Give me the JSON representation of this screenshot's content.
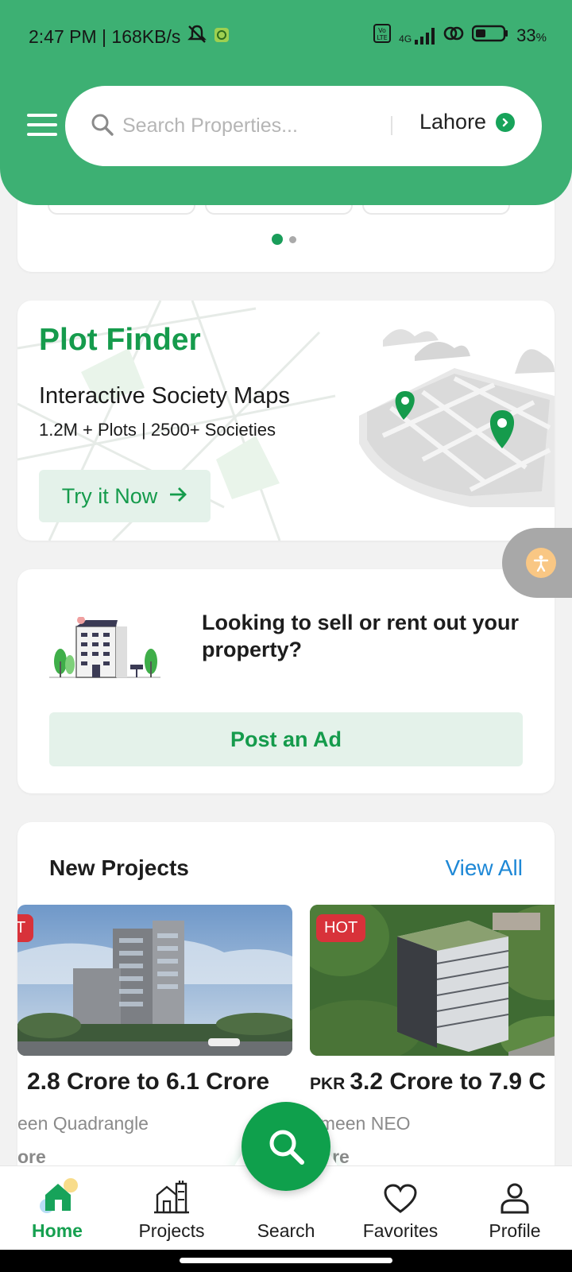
{
  "status_bar": {
    "time_speed": "2:47 PM | 168KB/s",
    "network": "4G",
    "battery": "33",
    "battery_unit": "%"
  },
  "search": {
    "placeholder": "Search Properties...",
    "city": "Lahore"
  },
  "carousel": {
    "active_index": 0,
    "count": 2
  },
  "plot_finder": {
    "title": "Plot Finder",
    "subtitle": "Interactive Society Maps",
    "stats": "1.2M + Plots | 2500+ Societies",
    "cta": "Try it Now"
  },
  "sell_card": {
    "text": "Looking to sell or rent out your property?",
    "cta": "Post an Ad"
  },
  "new_projects": {
    "heading": "New Projects",
    "view_all": "View All",
    "items": [
      {
        "badge": "T",
        "currency": "",
        "price": "2.8 Crore to 6.1 Crore",
        "name": "een Quadrangle",
        "city": "ore"
      },
      {
        "badge": "HOT",
        "currency": "PKR",
        "price": "3.2 Crore to 7.9 C",
        "name": "ameen NEO",
        "city": "hore"
      }
    ]
  },
  "nav": {
    "home": "Home",
    "projects": "Projects",
    "search": "Search",
    "favorites": "Favorites",
    "profile": "Profile",
    "active": "home"
  },
  "colors": {
    "brand_green": "#3db073",
    "accent_green": "#159b4c",
    "link_blue": "#1e88d6",
    "hot_red": "#d8323a"
  }
}
